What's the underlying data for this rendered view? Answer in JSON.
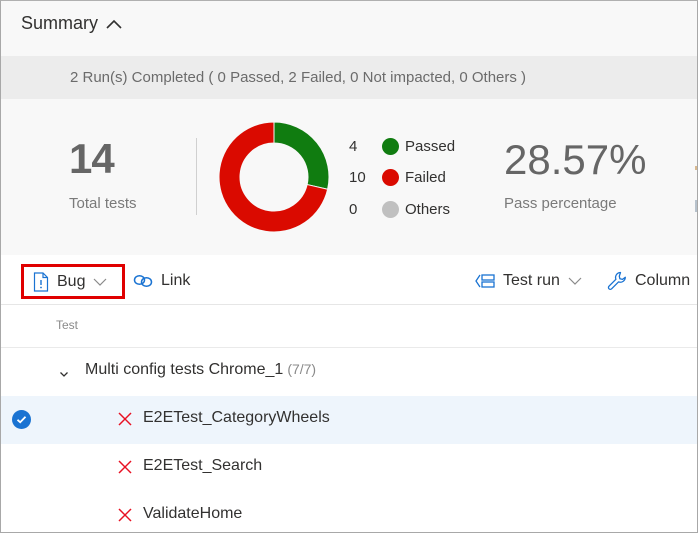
{
  "summary": {
    "title": "Summary",
    "runs_banner": "2 Run(s) Completed ( 0 Passed, 2 Failed, 0 Not impacted, 0 Others )",
    "total_tests": {
      "value": "14",
      "label": "Total tests"
    },
    "pass_percentage": {
      "value": "28.57%",
      "label": "Pass percentage"
    },
    "outcomes": [
      {
        "count": "4",
        "label": "Passed",
        "color": "#107c10"
      },
      {
        "count": "10",
        "label": "Failed",
        "color": "#da0a00"
      },
      {
        "count": "0",
        "label": "Others",
        "color": "#c0c0c0"
      }
    ]
  },
  "chart_data": {
    "type": "pie",
    "style": "donut",
    "title": "",
    "categories": [
      "Passed",
      "Failed",
      "Others"
    ],
    "values": [
      4,
      10,
      0
    ],
    "colors": [
      "#107c10",
      "#da0a00",
      "#c0c0c0"
    ],
    "legend": "right"
  },
  "toolbar": {
    "bug_label": "Bug",
    "link_label": "Link",
    "test_run_label": "Test run",
    "column_label": "Column"
  },
  "table": {
    "column_header": "Test",
    "group": {
      "name": "Multi config tests Chrome_1",
      "count": "(7/7)"
    },
    "rows": [
      {
        "name": "E2ETest_CategoryWheels",
        "outcome": "failed",
        "selected": true
      },
      {
        "name": "E2ETest_Search",
        "outcome": "failed",
        "selected": false
      },
      {
        "name": "ValidateHome",
        "outcome": "failed",
        "selected": false
      }
    ]
  },
  "colors": {
    "accent": "#1a73d2",
    "failed": "#e81123",
    "highlight_box": "#e00000"
  }
}
